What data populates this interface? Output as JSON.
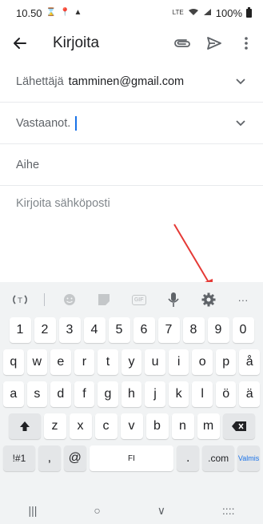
{
  "status_bar": {
    "time": "10.50",
    "battery": "100%",
    "network": "LTE"
  },
  "app_bar": {
    "title": "Kirjoita",
    "icons": [
      "back-arrow-icon",
      "attach-icon",
      "send-icon",
      "more-vert-icon"
    ]
  },
  "compose": {
    "from_label": "Lähettäjä",
    "from_value": "tamminen@gmail.com",
    "to_label": "Vastaanot.",
    "subject_placeholder": "Aihe",
    "body_placeholder": "Kirjoita sähköposti"
  },
  "keyboard": {
    "toolbar_icons": [
      "translate-icon",
      "emoji-icon",
      "sticker-icon",
      "gif-icon",
      "mic-icon",
      "gear-icon",
      "more-horiz-icon"
    ],
    "gif_label": "GIF",
    "more_label": "···",
    "rows": [
      [
        "1",
        "2",
        "3",
        "4",
        "5",
        "6",
        "7",
        "8",
        "9",
        "0"
      ],
      [
        "q",
        "w",
        "e",
        "r",
        "t",
        "y",
        "u",
        "i",
        "o",
        "p",
        "å"
      ],
      [
        "a",
        "s",
        "d",
        "f",
        "g",
        "h",
        "j",
        "k",
        "l",
        "ö",
        "ä"
      ],
      [
        "z",
        "x",
        "c",
        "v",
        "b",
        "n",
        "m"
      ]
    ],
    "symbols_key": "!#1",
    "comma_key": ",",
    "at_key": "@",
    "space_label": "FI",
    "period_key": ".",
    "dotcom_key": ".com",
    "done_key": "Valmis",
    "nav": [
      "|||",
      "○",
      "∨",
      "::::"
    ]
  },
  "annotation": {
    "arrow_color": "#e53935"
  }
}
